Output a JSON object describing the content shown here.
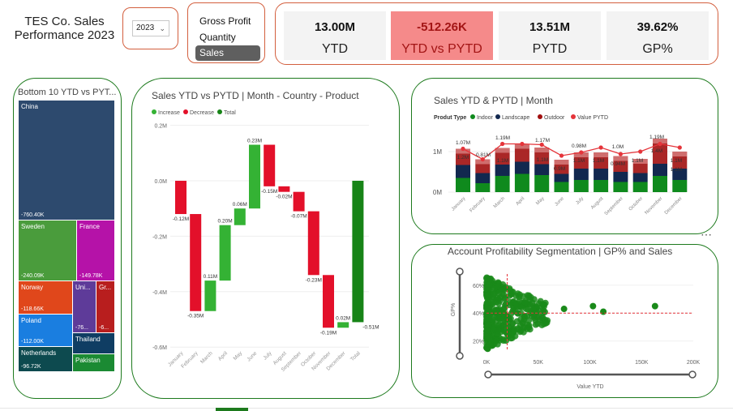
{
  "header": {
    "title_line1": "TES Co. Sales",
    "title_line2": "Performance 2023"
  },
  "year_filter": {
    "selected": "2023"
  },
  "metric_selector": {
    "items": [
      "Gross Profit",
      "Quantity",
      "Sales"
    ],
    "selected": "Sales"
  },
  "kpis": [
    {
      "value": "13.00M",
      "label": "YTD"
    },
    {
      "value": "-512.26K",
      "label": "YTD vs PYTD"
    },
    {
      "value": "13.51M",
      "label": "PYTD"
    },
    {
      "value": "39.62%",
      "label": "GP%"
    }
  ],
  "colors": {
    "accent_border": "#d35f3e",
    "panel_border": "#1d7a1d",
    "increase": "#34b234",
    "decrease": "#e3102a",
    "total": "#178417",
    "indoor": "#0f8a1d",
    "landscape": "#12284f",
    "outdoor": "#a10f0f",
    "value_pytd": "#e5343a",
    "treemap_navy": "#2d4a6e",
    "treemap_green": "#4a9c3c",
    "treemap_magenta": "#b512a8"
  },
  "treemap": {
    "title": "Bottom 10 YTD vs PYT...",
    "cells": [
      {
        "name": "China",
        "value": "-760.40K",
        "color": "#2d4a6e"
      },
      {
        "name": "Sweden",
        "value": "-240.09K",
        "color": "#4a9c3c"
      },
      {
        "name": "France",
        "value": "-149.78K",
        "color": "#b512a8"
      },
      {
        "name": "Norway",
        "value": "-118.66K",
        "color": "#e0471b"
      },
      {
        "name": "Uni...",
        "value": "-76...",
        "color": "#5e3b99"
      },
      {
        "name": "Gr...",
        "value": "-6...",
        "color": "#b81e1e"
      },
      {
        "name": "Poland",
        "value": "-112.00K",
        "color": "#1a7ee0"
      },
      {
        "name": "Thailand",
        "value": "",
        "color": "#0f3d63"
      },
      {
        "name": "Netherlands",
        "value": "-96.72K",
        "color": "#0d4a4f"
      },
      {
        "name": "Pakistan",
        "value": "",
        "color": "#1b8a33"
      }
    ]
  },
  "chart_data": [
    {
      "type": "bar",
      "subtype": "waterfall",
      "title": "Sales YTD vs PYTD | Month - Country - Product",
      "legend": [
        "Increase",
        "Decrease",
        "Total"
      ],
      "categories": [
        "January",
        "February",
        "March",
        "April",
        "May",
        "June",
        "July",
        "August",
        "September",
        "October",
        "November",
        "December",
        "Total"
      ],
      "values": [
        -0.12,
        -0.35,
        0.11,
        0.2,
        0.06,
        0.23,
        -0.15,
        -0.02,
        -0.07,
        -0.23,
        -0.19,
        0.02,
        -0.51
      ],
      "data_labels": [
        "-0.12M",
        "-0.35M",
        "0.11M",
        "0.20M",
        "0.06M",
        "0.23M",
        "-0.15M",
        "-0.02M",
        "-0.07M",
        "-0.23M",
        "-0.19M",
        "0.02M",
        "-0.51M"
      ],
      "yticks": [
        "0.2M",
        "0.0M",
        "-0.2M",
        "-0.4M",
        "-0.6M"
      ],
      "ylim": [
        -0.6,
        0.2
      ],
      "grid": true,
      "legend_position": "top-left"
    },
    {
      "type": "bar",
      "subtype": "stacked-bar-with-line",
      "title": "Sales YTD & PYTD | Month",
      "legend_title": "Produt Type",
      "categories": [
        "January",
        "February",
        "March",
        "April",
        "May",
        "June",
        "July",
        "August",
        "September",
        "October",
        "November",
        "December"
      ],
      "series": [
        {
          "name": "Indoor",
          "values": [
            0.35,
            0.22,
            0.4,
            0.45,
            0.42,
            0.25,
            0.3,
            0.3,
            0.25,
            0.25,
            0.4,
            0.3
          ]
        },
        {
          "name": "Landscape",
          "values": [
            0.32,
            0.25,
            0.28,
            0.3,
            0.27,
            0.2,
            0.28,
            0.28,
            0.25,
            0.22,
            0.3,
            0.28
          ]
        },
        {
          "name": "Outdoor",
          "values": [
            0.4,
            0.34,
            0.41,
            0.44,
            0.41,
            0.35,
            0.4,
            0.4,
            0.39,
            0.35,
            0.62,
            0.42
          ]
        },
        {
          "name": "Value PYTD",
          "values": [
            1.07,
            0.81,
            1.19,
            1.19,
            1.17,
            0.9,
            0.98,
            1.1,
            0.94,
            1.0,
            1.19,
            1.1
          ]
        }
      ],
      "data_labels": [
        "1.07M",
        "1.2M",
        "0.81M",
        "1.19M",
        "1.1M",
        "1.17M",
        "1.1M",
        "0.9M",
        "0.98M",
        "1.1M",
        "1.1M",
        "1.0M",
        "0.94M",
        "1.1M",
        "1.4M",
        "1.19M",
        "1.1M",
        "1.1M"
      ],
      "yticks": [
        "1M",
        "0M"
      ],
      "ylim": [
        0,
        1.6
      ],
      "legend_position": "top-left"
    },
    {
      "type": "scatter",
      "title": "Account Profitability Segmentation | GP% and Sales",
      "xlabel": "Value YTD",
      "ylabel": "GP%",
      "xticks": [
        "0K",
        "50K",
        "100K",
        "150K",
        "200K"
      ],
      "yticks": [
        "60%",
        "40%",
        "20%"
      ],
      "xlim": [
        0,
        200
      ],
      "ylim": [
        14,
        68
      ],
      "reference_line_y": 40,
      "outliers": [
        {
          "x": 75,
          "y": 43
        },
        {
          "x": 103,
          "y": 45
        },
        {
          "x": 113,
          "y": 41
        },
        {
          "x": 163,
          "y": 45
        }
      ]
    }
  ]
}
